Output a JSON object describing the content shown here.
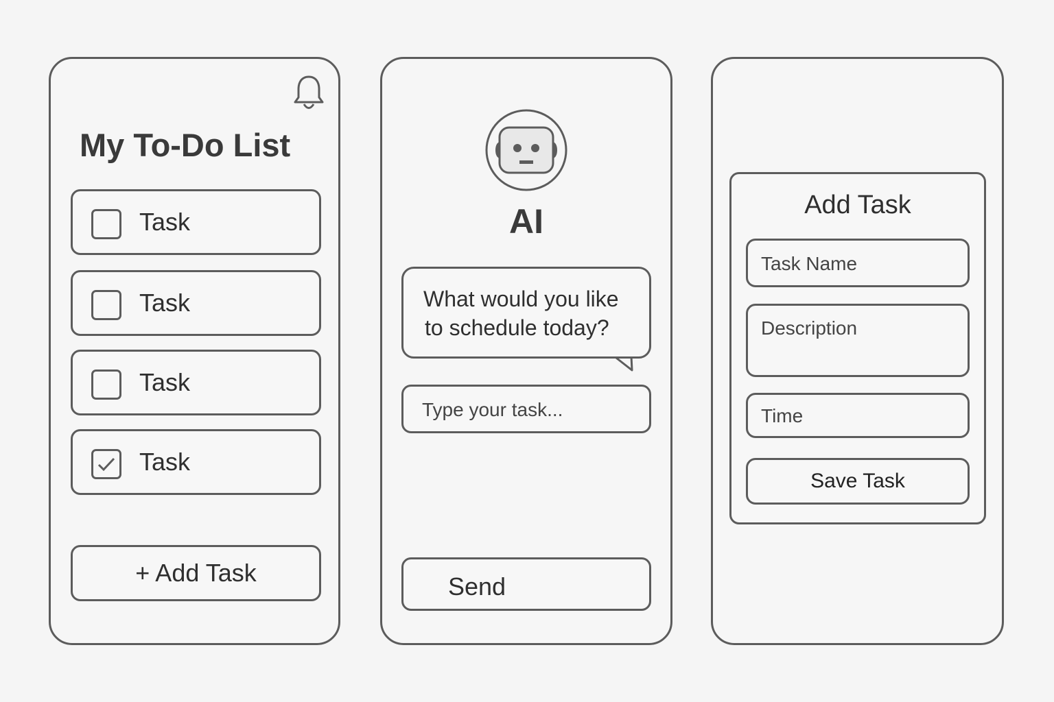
{
  "todo": {
    "title": "My To-Do List",
    "tasks": [
      {
        "label": "Task",
        "checked": false
      },
      {
        "label": "Task",
        "checked": false
      },
      {
        "label": "Task",
        "checked": false
      },
      {
        "label": "Task",
        "checked": true
      }
    ],
    "add_button": "+ Add Task"
  },
  "chat": {
    "assistant_name": "AI",
    "message_line1": "What would you like",
    "message_line2": "to schedule today?",
    "input_placeholder": "Type your task...",
    "send_button": "Send"
  },
  "form": {
    "title": "Add Task",
    "task_name_placeholder": "Task Name",
    "description_placeholder": "Description",
    "time_placeholder": "Time",
    "save_button": "Save Task"
  }
}
